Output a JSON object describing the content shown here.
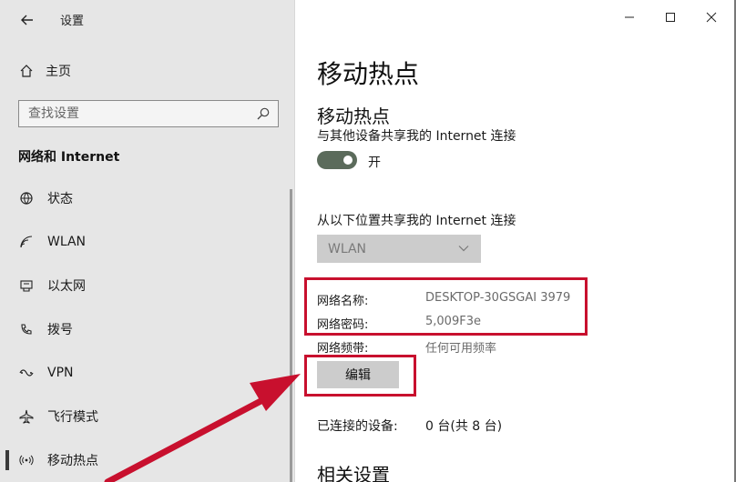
{
  "header": {
    "app_title": "设置"
  },
  "sidebar": {
    "home_label": "主页",
    "search_placeholder": "查找设置",
    "section_title": "网络和 Internet",
    "items": [
      {
        "label": "状态",
        "icon": "status-icon"
      },
      {
        "label": "WLAN",
        "icon": "wifi-icon"
      },
      {
        "label": "以太网",
        "icon": "ethernet-icon"
      },
      {
        "label": "拨号",
        "icon": "dialup-icon"
      },
      {
        "label": "VPN",
        "icon": "vpn-icon"
      },
      {
        "label": "飞行模式",
        "icon": "airplane-icon"
      },
      {
        "label": "移动热点",
        "icon": "hotspot-icon",
        "active": true
      }
    ]
  },
  "main": {
    "page_title": "移动热点",
    "sub_title": "移动热点",
    "share_desc": "与其他设备共享我的 Internet 连接",
    "toggle_state": "开",
    "share_from_label": "从以下位置共享我的 Internet 连接",
    "share_from_value": "WLAN",
    "network_name_label": "网络名称:",
    "network_name_value": "DESKTOP-30GSGAI 3979",
    "network_password_label": "网络密码:",
    "network_password_value": "5,009F3e",
    "network_band_label": "网络频带:",
    "network_band_value": "任何可用频率",
    "edit_button": "编辑",
    "connected_label": "已连接的设备:",
    "connected_value": "0 台(共 8 台)",
    "related_title": "相关设置"
  },
  "colors": {
    "annotation_red": "#c8102e",
    "toggle_on": "#5b6b5b"
  }
}
